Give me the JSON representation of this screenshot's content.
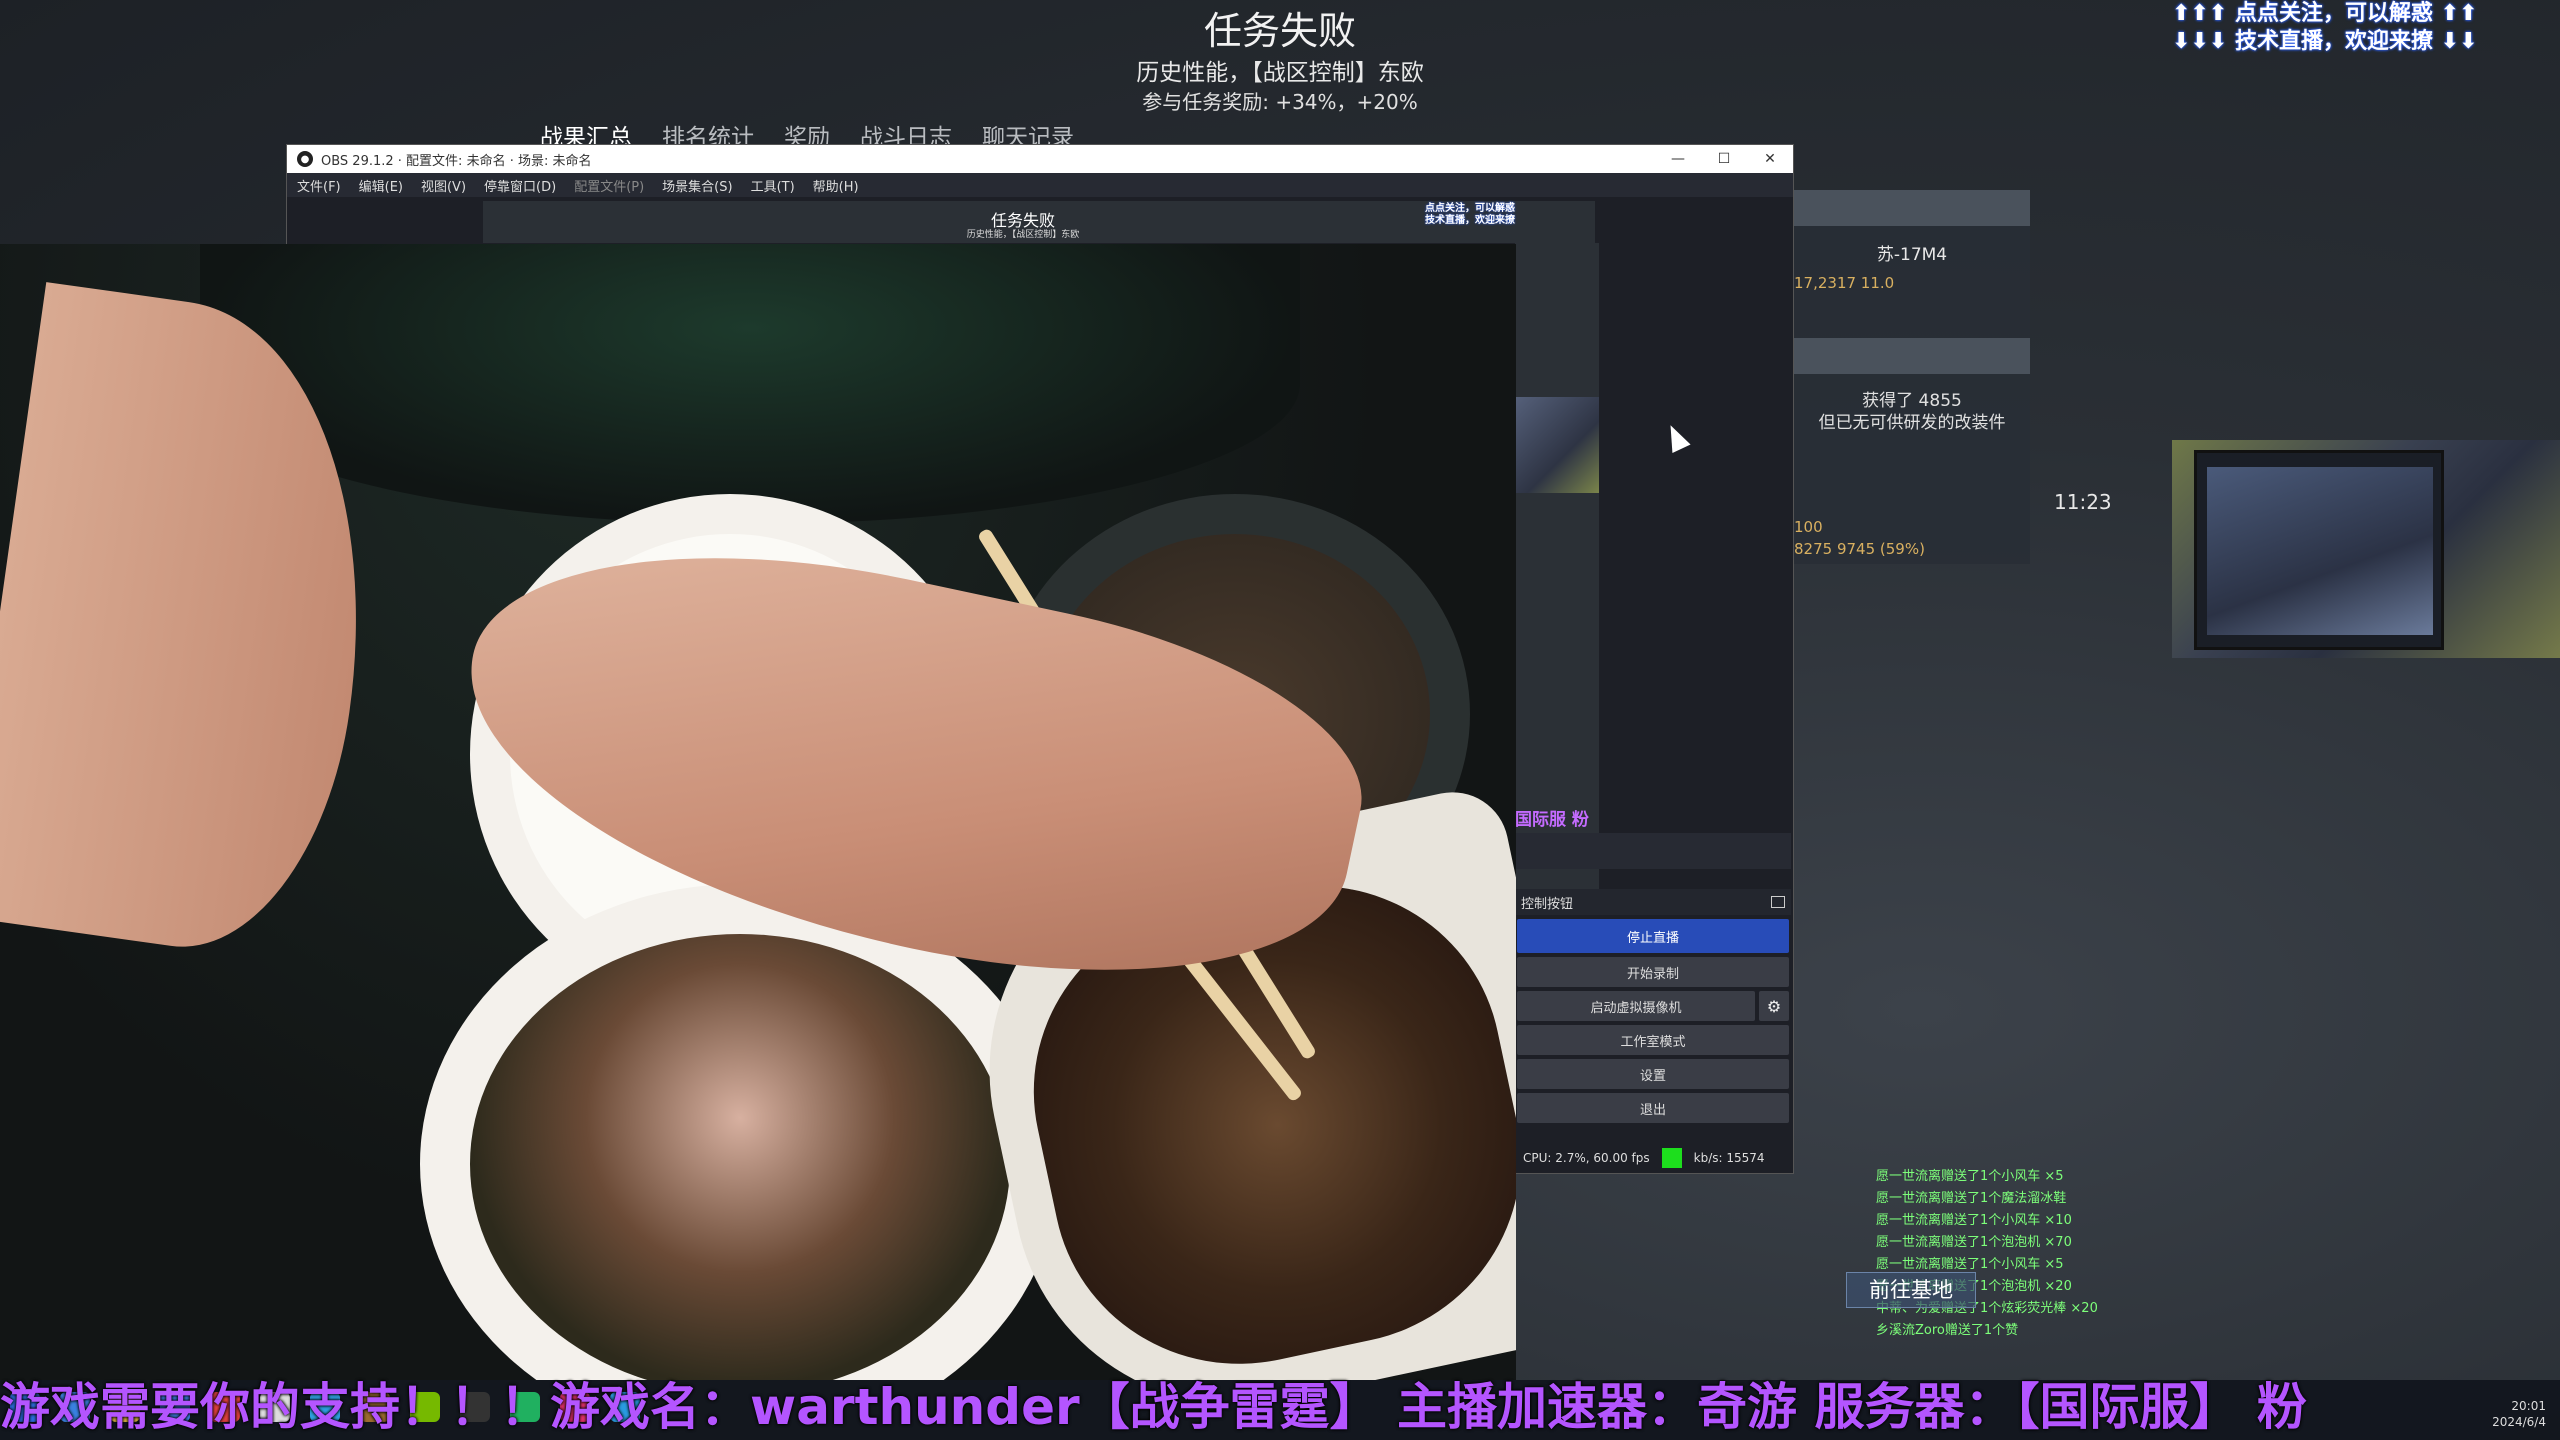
{
  "game": {
    "title": "任务失败",
    "subtitle": "历史性能，【战区控制】东欧",
    "reward": "参与任务奖励: +34%，+20%",
    "tabs": [
      "战果汇总",
      "排名统计",
      "奖励",
      "战斗日志",
      "聊天记录"
    ],
    "overlay_top_right": [
      "点点关注，可以解惑",
      "技术直播，欢迎来撩"
    ],
    "right_panel": {
      "player": "苏-17M4",
      "player_stats": "17,2317  11.0",
      "earned_line1": "获得了 4855",
      "earned_line2": "但已无可供研发的改装件",
      "time": "11:23",
      "reward_line1": "100",
      "reward_line2": "8275  9745 (59%)"
    },
    "chat_feed": [
      "愿一世流离赠送了1个小风车 ×5",
      "愿一世流离赠送了1个魔法溜冰鞋",
      "愿一世流离赠送了1个小风车 ×10",
      "愿一世流离赠送了1个泡泡机 ×70",
      "愿一世流离赠送了1个小风车 ×5",
      "愿一世流离赠送了1个泡泡机 ×20",
      "中蒂、为爱赠送了1个炫彩荧光棒 ×20",
      "乡溪流Zoro赠送了1个赞"
    ],
    "go_base": "前往基地"
  },
  "obs": {
    "title": "OBS 29.1.2 · 配置文件: 未命名 · 场景: 未命名",
    "menu": [
      "文件(F)",
      "编辑(E)",
      "视图(V)",
      "停靠窗口(D)",
      "配置文件(P)",
      "场景集合(S)",
      "工具(T)",
      "帮助(H)"
    ],
    "preview_title": "任务失败",
    "preview_sub": "历史性能，【战区控制】东欧",
    "preview_overlay": [
      "点点关注，可以解惑",
      "技术直播，欢迎来撩"
    ],
    "preview_ticker": "国际服 粉",
    "controls": {
      "header": "控制按钮",
      "stop_stream": "停止直播",
      "start_record": "开始录制",
      "virtual_cam": "启动虚拟摄像机",
      "studio_mode": "工作室模式",
      "settings": "设置",
      "exit": "退出"
    },
    "status": {
      "cpu": "CPU: 2.7%, 60.00 fps",
      "kbps": "kb/s: 15574"
    },
    "win_controls": [
      "—",
      "☐",
      "✕"
    ]
  },
  "ticker": "游戏需要你的支持！！！游戏名：warthunder【战争雷霆】 主播加速器：奇游 服务器：【国际服】 粉",
  "tray_clock": [
    "20:01",
    "2024/6/4"
  ]
}
